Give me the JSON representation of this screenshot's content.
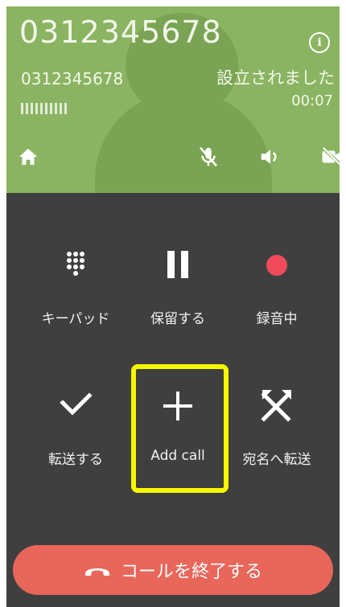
{
  "call": {
    "number": "0312345678",
    "sub_number": "0312345678",
    "status": "設立されました",
    "duration": "00:07"
  },
  "header_icons": [
    "home-icon",
    "mic-off-icon",
    "speaker-icon",
    "video-off-icon",
    "info-icon"
  ],
  "controls": {
    "keypad": {
      "label": "キーパッド",
      "icon": "keypad-icon"
    },
    "hold": {
      "label": "保留する",
      "icon": "pause-icon"
    },
    "record": {
      "label": "録音中",
      "icon": "record-icon"
    },
    "transfer": {
      "label": "転送する",
      "icon": "transfer-icon"
    },
    "add_call": {
      "label": "Add call",
      "icon": "plus-icon"
    },
    "blind_transfer": {
      "label": "宛名へ転送",
      "icon": "merge-icon"
    }
  },
  "end_call": {
    "label": "コールを終了する",
    "icon": "hangup-icon"
  },
  "colors": {
    "header_bg": "#8bb462",
    "panel_bg": "#3f3f3f",
    "end_call_bg": "#e8665a",
    "record_dot": "#ef4b5b",
    "highlight": "#f6f600"
  }
}
